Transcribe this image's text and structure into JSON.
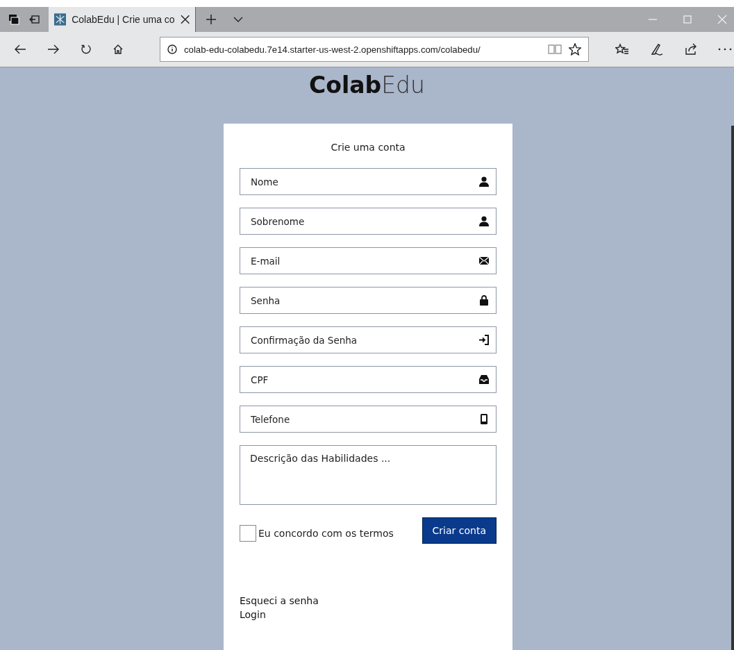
{
  "browser": {
    "tab": {
      "title": "ColabEdu | Crie uma co",
      "selected": true
    },
    "address": "colab-edu-colabedu.7e14.starter-us-west-2.openshiftapps.com/colabedu/"
  },
  "logo": {
    "bold": "Colab",
    "light": "Edu"
  },
  "form": {
    "title": "Crie uma conta",
    "fields": [
      {
        "kind": "input",
        "placeholder": "Nome"
      },
      {
        "kind": "input",
        "placeholder": "Sobrenome"
      },
      {
        "kind": "input",
        "placeholder": "E-mail"
      },
      {
        "kind": "input",
        "placeholder": "Senha"
      },
      {
        "kind": "input",
        "placeholder": "Confirmação da Senha"
      },
      {
        "kind": "input",
        "placeholder": "CPF"
      },
      {
        "kind": "input",
        "placeholder": "Telefone"
      },
      {
        "kind": "textarea",
        "placeholder": "Descrição das Habilidades ..."
      }
    ],
    "terms": {
      "label": "Eu concordo com os termos",
      "checked": false
    },
    "submit": "Criar conta",
    "links": [
      "Esqueci a senha",
      "Login"
    ]
  }
}
